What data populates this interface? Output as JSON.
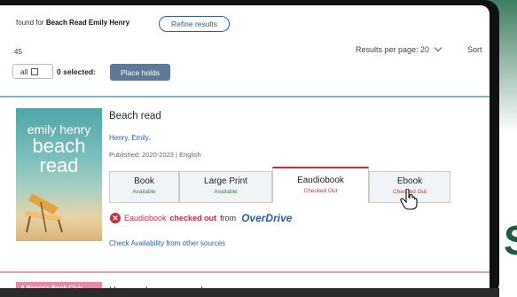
{
  "header": {
    "results_prefix": "found for",
    "query": "Beach Read Emily Henry",
    "refine_label": "Refine results"
  },
  "toolbar": {
    "count_fragment": "45",
    "per_page_label": "Results per page: 20",
    "sort_label": "Sort",
    "select_all_label": "all",
    "selected_text": "0 selected:",
    "place_holds_label": "Place holds"
  },
  "result1": {
    "cover": {
      "author": "emily henry",
      "title_line1": "beach",
      "title_line2": "read"
    },
    "title": "Beach read",
    "author": "Henry, Emily.",
    "published": "Published: 2020-2023 | English",
    "formats": [
      {
        "label": "Book",
        "status": "Available",
        "state": "available"
      },
      {
        "label": "Large Print",
        "status": "Available",
        "state": "available"
      },
      {
        "label": "Eaudiobook",
        "status": "Checked Out",
        "state": "checked-out"
      },
      {
        "label": "Ebook",
        "status": "Checked Out",
        "state": "checked-out"
      }
    ],
    "notice": {
      "format": "Eaudiobook",
      "status": "checked out",
      "from": "from",
      "provider": "OverDrive"
    },
    "check_availability": "Check Availability from other sources"
  },
  "result2": {
    "cover_label": "A Reese's Book Club",
    "title": "Happy place : a novel"
  },
  "colors": {
    "accent": "#2a5fa8",
    "available": "#2c8a3a",
    "checked_out": "#c0392b",
    "active_tab_border": "#c73040"
  },
  "icons": {
    "notice": "error-circle-icon",
    "per_page": "chevron-down-icon",
    "cursor": "hand-pointer-icon"
  }
}
